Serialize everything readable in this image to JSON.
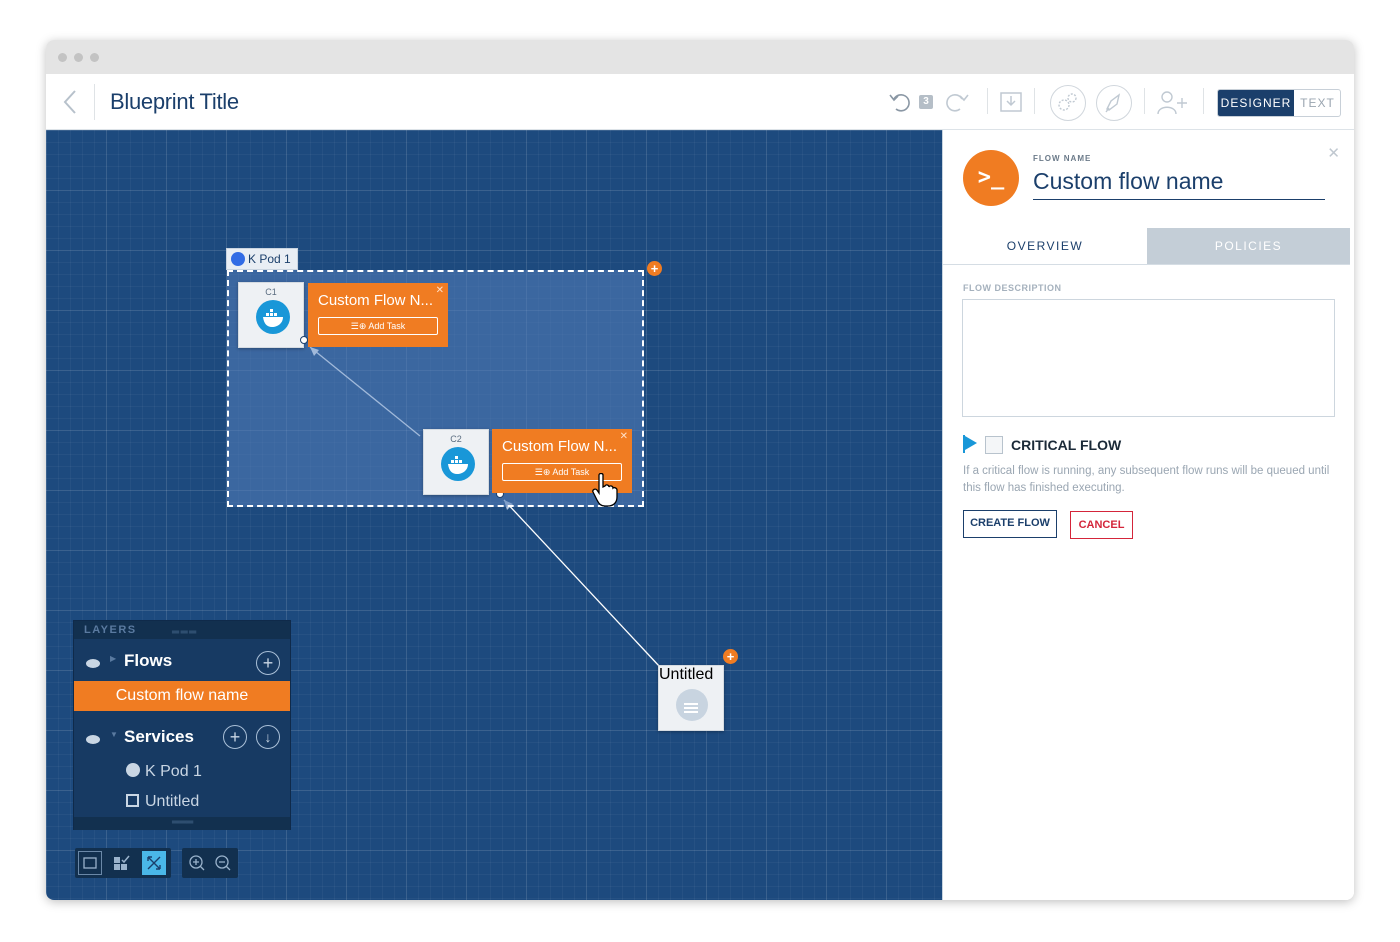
{
  "header": {
    "title": "Blueprint Title",
    "undo_count": "3",
    "view_toggle": {
      "designer": "DESIGNER",
      "text": "TEXT"
    }
  },
  "canvas": {
    "pod": {
      "label": "K Pod 1"
    },
    "containers": [
      {
        "label": "C1",
        "flow_name": "Custom Flow N...",
        "add_task": "Add Task"
      },
      {
        "label": "C2",
        "flow_name": "Custom Flow N...",
        "add_task": "Add Task"
      }
    ],
    "untitled": {
      "label": "Untitled"
    }
  },
  "layers": {
    "header": "LAYERS",
    "flows_label": "Flows",
    "selected_flow": "Custom flow name",
    "services_label": "Services",
    "services": [
      {
        "icon": "kubernetes-icon",
        "label": "K Pod 1"
      },
      {
        "icon": "document-icon",
        "label": "Untitled"
      }
    ]
  },
  "panel": {
    "flow_name_label": "FLOW NAME",
    "flow_name": "Custom flow name",
    "tabs": {
      "overview": "OVERVIEW",
      "policies": "POLICIES"
    },
    "flow_description_label": "FLOW DESCRIPTION",
    "flow_description": "",
    "critical_flow_label": "CRITICAL FLOW",
    "critical_flow_checked": false,
    "critical_flow_help": "If a critical flow is running, any subsequent flow runs will be queued until this flow has finished executing.",
    "create_button": "CREATE FLOW",
    "cancel_button": "CANCEL"
  },
  "colors": {
    "brand": "#1b3f6b",
    "accent": "#f07c22",
    "canvas": "#1d4a7e",
    "danger": "#d4253a",
    "info": "#1997d8"
  }
}
